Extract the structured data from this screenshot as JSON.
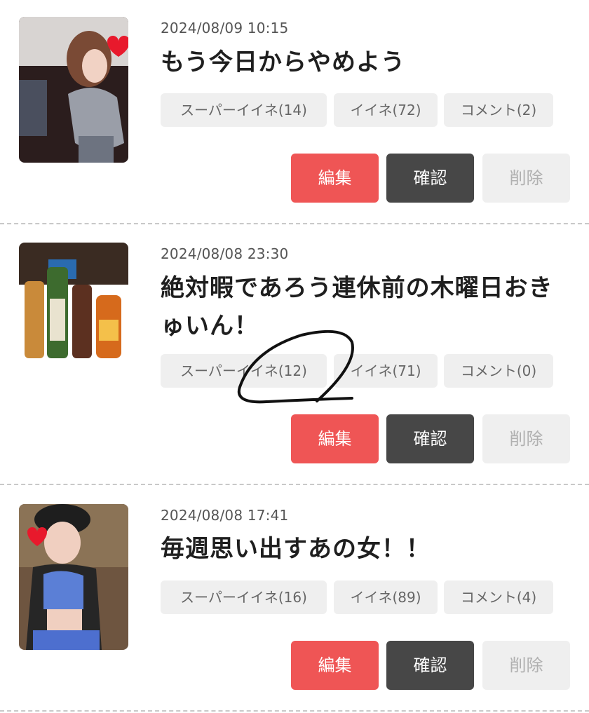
{
  "posts": [
    {
      "date": "2024/08/09 10:15",
      "title": "もう今日からやめよう",
      "super_like": "スーパーイイネ(14)",
      "like": "イイネ(72)",
      "comment": "コメント(2)"
    },
    {
      "date": "2024/08/08 23:30",
      "title": "絶対暇であろう連休前の木曜日おきゅいん！",
      "super_like": "スーパーイイネ(12)",
      "like": "イイネ(71)",
      "comment": "コメント(0)"
    },
    {
      "date": "2024/08/08 17:41",
      "title": "毎週思い出すあの女！！",
      "super_like": "スーパーイイネ(16)",
      "like": "イイネ(89)",
      "comment": "コメント(4)"
    }
  ],
  "actions": {
    "edit_label": "編集",
    "confirm_label": "確認",
    "delete_label": "削除"
  },
  "colors": {
    "edit": "#ef5555",
    "confirm": "#474747",
    "delete_bg": "#efefef",
    "pill_bg": "#efefef"
  }
}
